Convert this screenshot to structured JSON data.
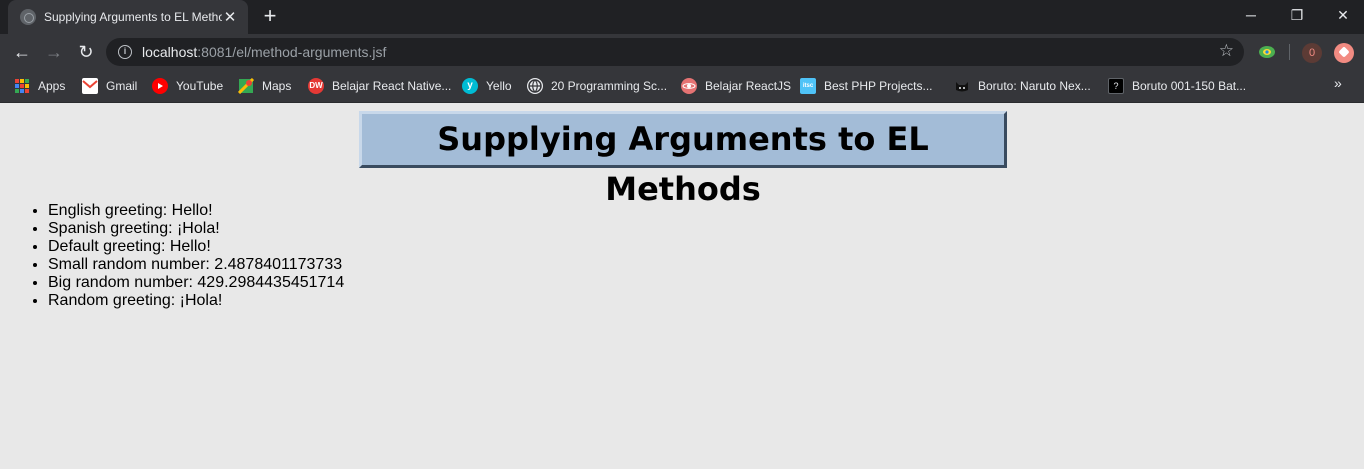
{
  "browser": {
    "tab": {
      "title": "Supplying Arguments to EL Methods"
    },
    "new_tab": "+",
    "window_controls": {
      "minimize": "─",
      "restore": "❐",
      "close": "✕"
    },
    "nav": {
      "back": "←",
      "forward": "→",
      "reload": "↻"
    },
    "address": {
      "host": "localhost",
      "rest": ":8081/el/method-arguments.jsf"
    },
    "extensions": {
      "count_badge": "0"
    },
    "bookmarks": [
      {
        "label": "Apps",
        "icon": "apps-grid-icon"
      },
      {
        "label": "Gmail",
        "icon": "gmail-icon",
        "color": "#ea4335"
      },
      {
        "label": "YouTube",
        "icon": "youtube-icon",
        "color": "#ff0000"
      },
      {
        "label": "Maps",
        "icon": "maps-icon",
        "color": "#34a853"
      },
      {
        "label": "Belajar React Native...",
        "icon": "dw-icon",
        "color": "#e53935"
      },
      {
        "label": "Yello",
        "icon": "yello-icon",
        "color": "#00bcd4"
      },
      {
        "label": "20 Programming Sc...",
        "icon": "globe-icon",
        "color": "#e8eaed"
      },
      {
        "label": "Belajar ReactJS",
        "icon": "react-icon",
        "color": "#e57373"
      },
      {
        "label": "Best PHP Projects...",
        "icon": "itsc-icon",
        "color": "#4fc3f7"
      },
      {
        "label": "Boruto: Naruto Nex...",
        "icon": "cat-icon",
        "color": "#111111"
      },
      {
        "label": "Boruto 001-150 Bat...",
        "icon": "boruto-icon",
        "color": "#000000"
      }
    ],
    "bookmarks_more": "»"
  },
  "page": {
    "heading": "Supplying Arguments to EL Methods",
    "items": [
      "English greeting: Hello!",
      "Spanish greeting: ¡Hola!",
      "Default greeting: Hello!",
      "Small random number: 2.4878401173733",
      "Big random number: 429.2984435451714",
      "Random greeting: ¡Hola!"
    ]
  }
}
